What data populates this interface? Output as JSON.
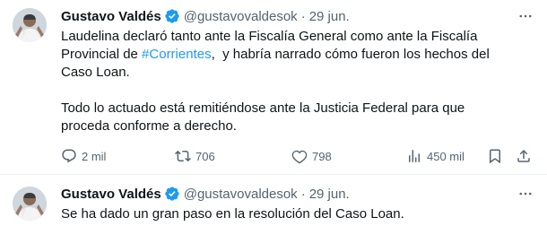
{
  "colors": {
    "text": "#0f1419",
    "muted": "#536471",
    "link": "#1d9bf0",
    "verified": "#1d9bf0",
    "divider": "#eff3f4"
  },
  "tweets": [
    {
      "author": "Gustavo Valdés",
      "handle": "@gustavovaldesok",
      "separator": "·",
      "time": "29 jun.",
      "body": {
        "l1": "Laudelina declaró tanto ante la Fiscalía General como ante la Fiscalía",
        "l2_pre": "Provincial de ",
        "l2_hashtag": "#Corrientes",
        "l2_post": ",  y habría narrado cómo fueron los hechos del",
        "l3": "Caso Loan.",
        "l4": "Todo lo actuado está remitiéndose ante la Justicia Federal para que",
        "l5": "proceda conforme a derecho."
      },
      "actions": {
        "replies": "2 mil",
        "reposts": "706",
        "likes": "798",
        "views": "450 mil"
      }
    },
    {
      "author": "Gustavo Valdés",
      "handle": "@gustavovaldesok",
      "separator": "·",
      "time": "29 jun.",
      "body": {
        "l1": "Se ha dado un gran paso en la resolución del Caso Loan."
      }
    }
  ],
  "icons": {
    "avatar": "avatar",
    "verified": "verified-badge-icon",
    "more": "more-options-icon",
    "reply": "reply-icon",
    "repost": "repost-icon",
    "like": "heart-icon",
    "views": "views-chart-icon",
    "bookmark": "bookmark-icon",
    "share": "share-icon"
  }
}
